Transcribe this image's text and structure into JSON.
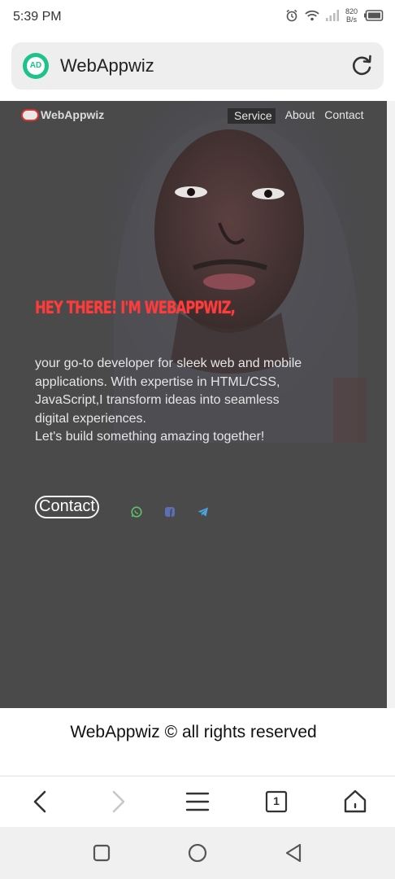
{
  "status_bar": {
    "time": "5:39 PM",
    "speed_value": "820",
    "speed_unit": "B/s",
    "icons": [
      "alarm-icon",
      "wifi-icon",
      "signal-icon",
      "battery-icon"
    ]
  },
  "address_bar": {
    "site_badge": "AD",
    "title": "WebAppwiz",
    "reload_icon": "reload-icon"
  },
  "site": {
    "brand": "WebAppwiz",
    "nav": [
      "Service",
      "About",
      "Contact"
    ],
    "headline": "HEY THERE! I'M WEBAPPWIZ,",
    "intro_lines": [
      "your go-to developer for sleek web and mobile",
      "applications. With expertise in HTML/CSS,",
      "JavaScript,I transform ideas into seamless",
      "digital experiences.",
      "Let's build something amazing together!"
    ],
    "contact_button": "Contact",
    "social_icons": [
      "whatsapp-icon",
      "facebook-icon",
      "telegram-icon"
    ],
    "colors": {
      "background": "#4a4a4a",
      "headline": "#ff3b3b",
      "text": "#e6e6e6"
    }
  },
  "footer": {
    "text": "WebAppwiz © all rights reserved"
  },
  "browser_nav": {
    "tab_count": "1",
    "icons": [
      "back-icon",
      "forward-icon",
      "menu-icon",
      "tabs-icon",
      "home-icon"
    ]
  },
  "system_nav": {
    "icons": [
      "recents-icon",
      "home-circle-icon",
      "back-triangle-icon"
    ]
  }
}
